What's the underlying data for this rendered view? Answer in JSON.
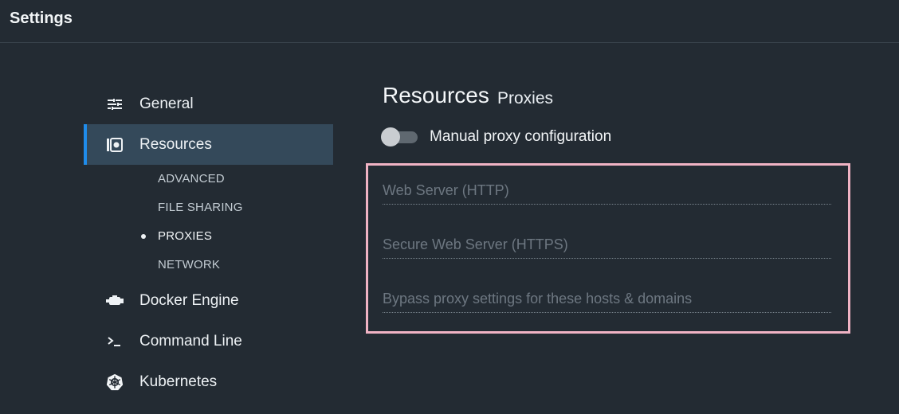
{
  "window": {
    "title": "Settings"
  },
  "sidebar": {
    "items": [
      {
        "label": "General",
        "icon": "sliders-icon"
      },
      {
        "label": "Resources",
        "icon": "resources-icon",
        "active": true
      },
      {
        "label": "Docker Engine",
        "icon": "docker-engine-icon"
      },
      {
        "label": "Command Line",
        "icon": "terminal-icon"
      },
      {
        "label": "Kubernetes",
        "icon": "kubernetes-helm-icon"
      }
    ],
    "subitems": [
      {
        "label": "ADVANCED"
      },
      {
        "label": "FILE SHARING"
      },
      {
        "label": "PROXIES",
        "selected": true
      },
      {
        "label": "NETWORK"
      }
    ]
  },
  "main": {
    "heading": "Resources",
    "subheading": "Proxies",
    "toggle": {
      "label": "Manual proxy configuration",
      "on": false
    },
    "fields": {
      "http": {
        "placeholder": "Web Server (HTTP)",
        "value": ""
      },
      "https": {
        "placeholder": "Secure Web Server (HTTPS)",
        "value": ""
      },
      "bypass": {
        "placeholder": "Bypass proxy settings for these hosts & domains",
        "value": ""
      }
    }
  },
  "colors": {
    "background": "#232b33",
    "active_item": "#34495a",
    "accent": "#1f8ceb",
    "highlight": "#f0b3c4"
  }
}
